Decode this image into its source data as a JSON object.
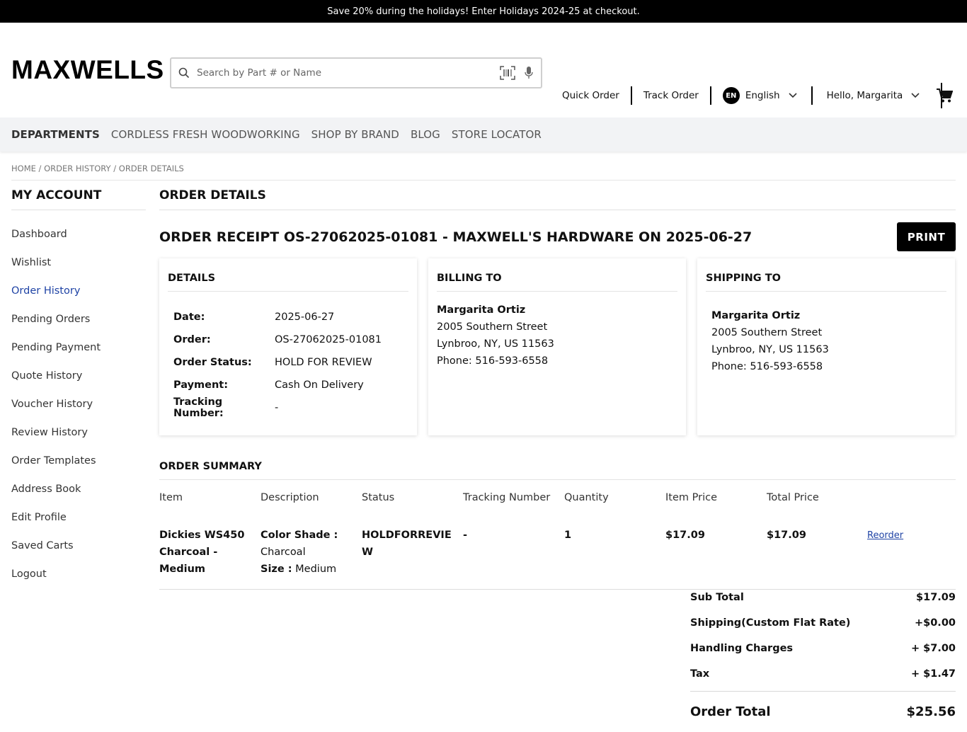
{
  "promo": "Save 20% during the holidays! Enter Holidays 2024-25 at checkout.",
  "logo": "MAXWELLS",
  "search": {
    "placeholder": "Search by Part # or Name"
  },
  "header_nav": {
    "quick_order": "Quick Order",
    "track_order": "Track Order",
    "lang_badge": "EN",
    "language": "English",
    "user": "Hello, Margarita"
  },
  "catnav": [
    "DEPARTMENTS",
    "CORDLESS FRESH WOODWORKING",
    "SHOP BY BRAND",
    "BLOG",
    "STORE LOCATOR"
  ],
  "breadcrumb": "HOME / ORDER HISTORY / ORDER DETAILS",
  "sidebar": {
    "title": "MY ACCOUNT",
    "items": [
      "Dashboard",
      "Wishlist",
      "Order History",
      "Pending Orders",
      "Pending Payment",
      "Quote History",
      "Voucher History",
      "Review History",
      "Order Templates",
      "Address Book",
      "Edit Profile",
      "Saved Carts",
      "Logout"
    ],
    "active": "Order History"
  },
  "page_title": "ORDER DETAILS",
  "receipt_title": "ORDER RECEIPT OS-27062025-01081 - MAXWELL'S HARDWARE ON 2025-06-27",
  "print_label": "PRINT",
  "details": {
    "title": "DETAILS",
    "rows": [
      {
        "label": "Date:",
        "value": "2025-06-27"
      },
      {
        "label": "Order:",
        "value": "OS-27062025-01081"
      },
      {
        "label": "Order Status:",
        "value": "HOLD FOR REVIEW"
      },
      {
        "label": "Payment:",
        "value": "Cash On Delivery"
      },
      {
        "label": "Tracking Number:",
        "value": "-"
      }
    ]
  },
  "billing": {
    "title": "BILLING TO",
    "name": "Margarita Ortiz",
    "street": "2005 Southern Street",
    "city": "Lynbroo, NY, US 11563",
    "phone": "Phone: 516-593-6558"
  },
  "shipping": {
    "title": "SHIPPING TO",
    "name": "Margarita Ortiz",
    "street": "2005 Southern Street",
    "city": "Lynbroo, NY, US 11563",
    "phone": "Phone: 516-593-6558"
  },
  "summary": {
    "title": "ORDER SUMMARY",
    "headers": [
      "Item",
      "Description",
      "Status",
      "Tracking Number",
      "Quantity",
      "Item Price",
      "Total Price",
      ""
    ],
    "row": {
      "item": "Dickies WS450 Charcoal - Medium",
      "color_label": "Color Shade :",
      "color_value": "Charcoal",
      "size_label": "Size :",
      "size_value": "Medium",
      "status": "HOLDFORREVIEW",
      "tracking": "-",
      "quantity": "1",
      "item_price": "$17.09",
      "total_price": "$17.09",
      "reorder": "Reorder"
    }
  },
  "totals": {
    "subtotal_label": "Sub Total",
    "subtotal": "$17.09",
    "shipping_label": "Shipping(Custom Flat Rate)",
    "shipping": "+$0.00",
    "handling_label": "Handling Charges",
    "handling": "+ $7.00",
    "tax_label": "Tax",
    "tax": "+ $1.47",
    "grand_label": "Order Total",
    "grand": "$25.56"
  }
}
